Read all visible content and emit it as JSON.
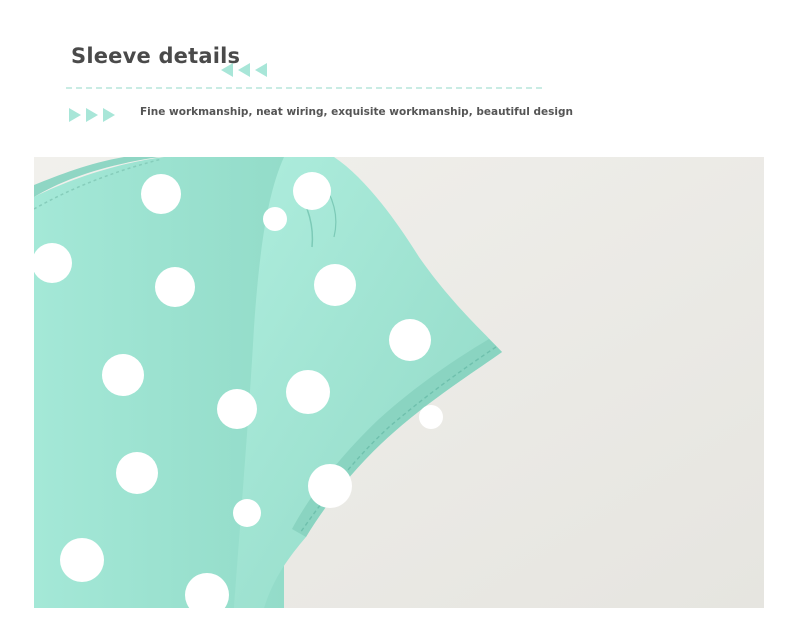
{
  "header": {
    "title": "Sleeve details",
    "subtitle": "Fine workmanship, neat wiring, exquisite workmanship, beautiful design"
  },
  "colors": {
    "accent": "#a8e6d8",
    "fabric": "#9de3d2",
    "dot": "#ffffff",
    "background": "#efeeea",
    "title_text": "#4a4a4a"
  },
  "photo": {
    "subject": "mint-green-polka-dot-tshirt-sleeve"
  }
}
